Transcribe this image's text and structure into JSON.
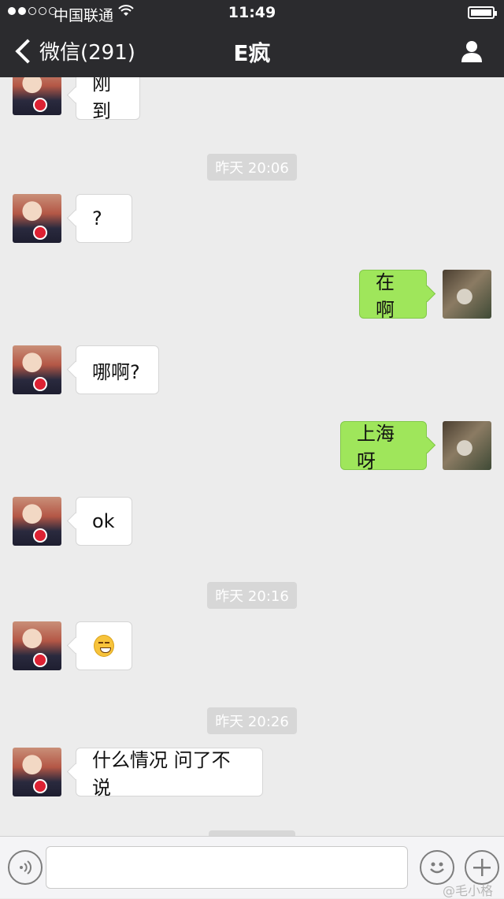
{
  "status_bar": {
    "carrier": "中国联通",
    "time": "11:49"
  },
  "nav": {
    "back_label": "微信(291)",
    "title": "E疯"
  },
  "messages": {
    "m0": {
      "text": "刚到"
    },
    "t1": "昨天 20:06",
    "m1": {
      "text": "?"
    },
    "m2": {
      "text": "在啊"
    },
    "m3": {
      "text": "哪啊?"
    },
    "m4": {
      "text": "上海呀"
    },
    "m5": {
      "text": "ok"
    },
    "t2": "昨天 20:16",
    "m6": {
      "emoji": "smirk-emoji"
    },
    "t3": "昨天 20:26",
    "m7": {
      "text": "什么情况 问了不说"
    }
  },
  "input_bar": {
    "placeholder": ""
  },
  "watermark": "@毛小格",
  "colors": {
    "header_bg": "#2b2b2e",
    "chat_bg": "#ececec",
    "outgoing_bubble": "#9fe65b",
    "incoming_bubble": "#ffffff",
    "timestamp_bg": "#d7d7d7"
  }
}
